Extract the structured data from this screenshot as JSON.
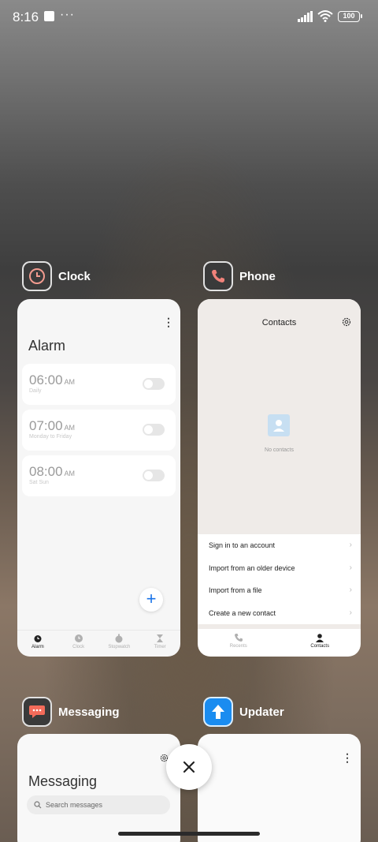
{
  "status_bar": {
    "time": "8:16",
    "dots": "···",
    "battery": "100"
  },
  "apps": {
    "clock": {
      "name": "Clock",
      "title": "Alarm",
      "more": "⋮",
      "alarms": [
        {
          "time": "06:00",
          "ampm": "AM",
          "repeat": "Daily"
        },
        {
          "time": "07:00",
          "ampm": "AM",
          "repeat": "Monday to Friday"
        },
        {
          "time": "08:00",
          "ampm": "AM",
          "repeat": "Sat Sun"
        }
      ],
      "fab": "+",
      "tabs": [
        "Alarm",
        "Clock",
        "Stopwatch",
        "Timer"
      ]
    },
    "phone": {
      "name": "Phone",
      "title": "Contacts",
      "empty": "No contacts",
      "menu": [
        "Sign in to an account",
        "Import from an older device",
        "Import from a file",
        "Create a new contact"
      ],
      "tabs": [
        "Recents",
        "Contacts"
      ]
    },
    "messaging": {
      "name": "Messaging",
      "title": "Messaging",
      "search_placeholder": "Search messages"
    },
    "updater": {
      "name": "Updater",
      "more": "⋮"
    }
  },
  "colors": {
    "clock_icon_bg": "#3a3a3a",
    "clock_accent": "#f29b8f",
    "phone_accent": "#f0827a",
    "messaging_accent": "#f36b5a",
    "updater_accent": "#1a8cf0"
  }
}
